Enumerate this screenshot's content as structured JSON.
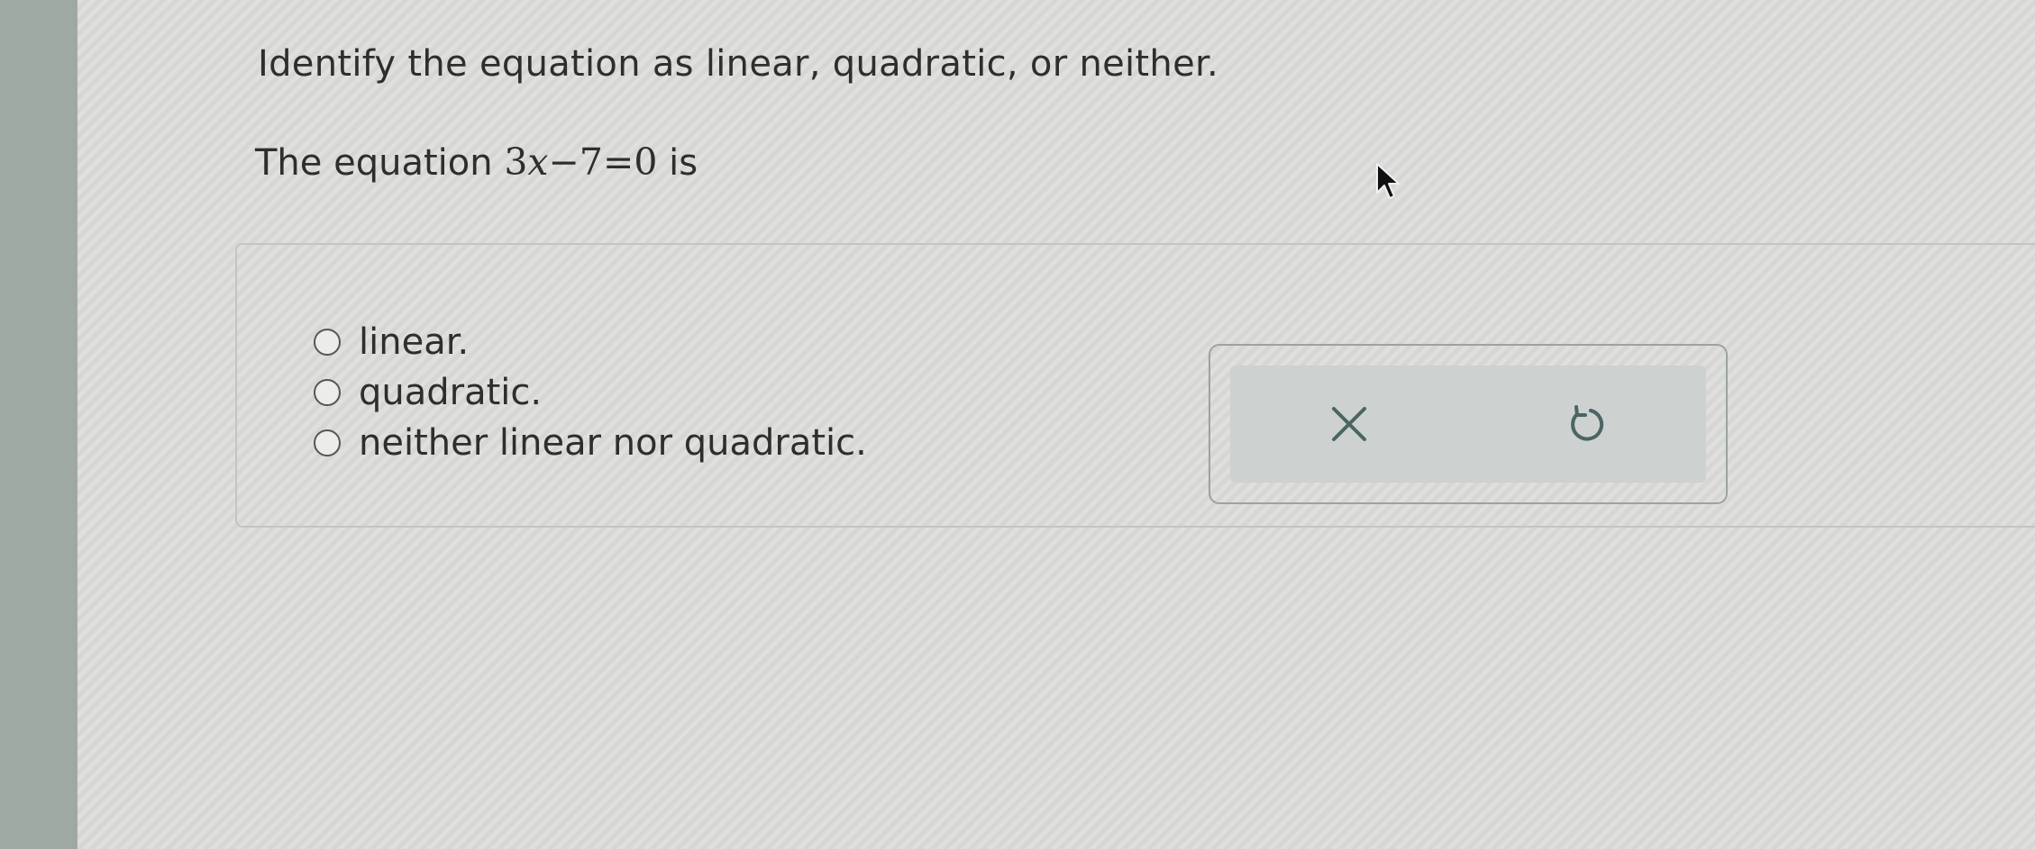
{
  "question": {
    "prompt": "Identify the equation as linear, quadratic, or neither.",
    "statement_prefix": "The equation",
    "equation": {
      "coefficient": "3",
      "variable": "x",
      "minus": "−",
      "constant": "7",
      "equals": "=",
      "rhs": "0"
    },
    "statement_suffix": "is"
  },
  "options": [
    {
      "label": "linear.",
      "selected": false
    },
    {
      "label": "quadratic.",
      "selected": false
    },
    {
      "label": "neither linear nor quadratic.",
      "selected": false
    }
  ],
  "tools": {
    "clear_icon": "close-icon",
    "undo_icon": "undo-icon",
    "icon_color": "#4a6563"
  }
}
